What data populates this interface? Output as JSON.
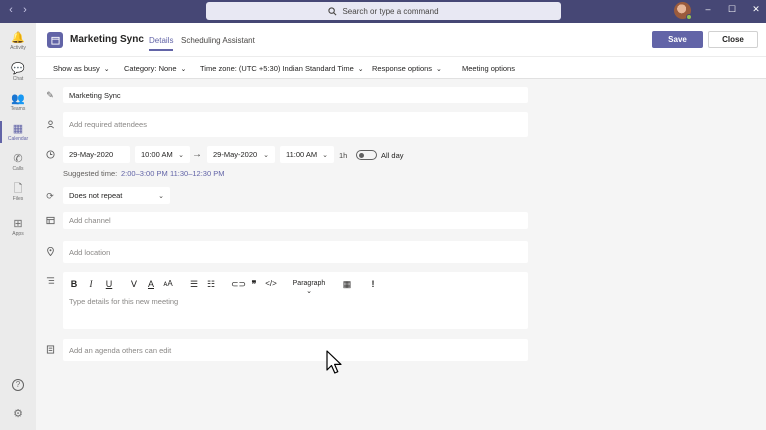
{
  "titlebar": {
    "search_placeholder": "Search or type a command",
    "nav_back": "‹",
    "nav_forward": "›",
    "minimize": "–",
    "maximize": "☐",
    "close": "✕"
  },
  "rail": [
    {
      "label": "Activity",
      "icon": "🔔"
    },
    {
      "label": "Chat",
      "icon": "💬"
    },
    {
      "label": "Teams",
      "icon": "👥"
    },
    {
      "label": "Calendar",
      "icon": "▦"
    },
    {
      "label": "Calls",
      "icon": "✆"
    },
    {
      "label": "Files",
      "icon": "🗋"
    },
    {
      "label": "Apps",
      "icon": "⊞"
    }
  ],
  "rail_active": "Calendar",
  "rail_bottom": {
    "help_icon": "?",
    "settings_icon": "⚙"
  },
  "header": {
    "title": "Marketing Sync",
    "tabs": [
      "Details",
      "Scheduling Assistant"
    ],
    "save_label": "Save",
    "close_label": "Close"
  },
  "toolbar": {
    "show_as": "Show as busy",
    "category": "Category: None",
    "timezone": "Time zone: (UTC +5:30) Indian Standard Time",
    "response_options": "Response options",
    "meeting_options": "Meeting options"
  },
  "form": {
    "title_value": "Marketing Sync",
    "attendees_placeholder": "Add required attendees",
    "start_date": "29-May-2020",
    "start_time": "10:00 AM",
    "end_date": "29-May-2020",
    "end_time": "11:00 AM",
    "duration": "1h",
    "all_day_label": "All day",
    "all_day": false,
    "suggested_label": "Suggested time:",
    "suggested_times": [
      "2:00–3:00 PM",
      "11:30–12:30 PM"
    ],
    "repeat": "Does not repeat",
    "channel_placeholder": "Add channel",
    "location_placeholder": "Add location",
    "details_placeholder": "Type details for this new meeting",
    "paragraph_label": "Paragraph",
    "agenda_placeholder": "Add an agenda others can edit"
  },
  "colors": {
    "accent": "#6264a7",
    "titlebar": "#464775"
  }
}
